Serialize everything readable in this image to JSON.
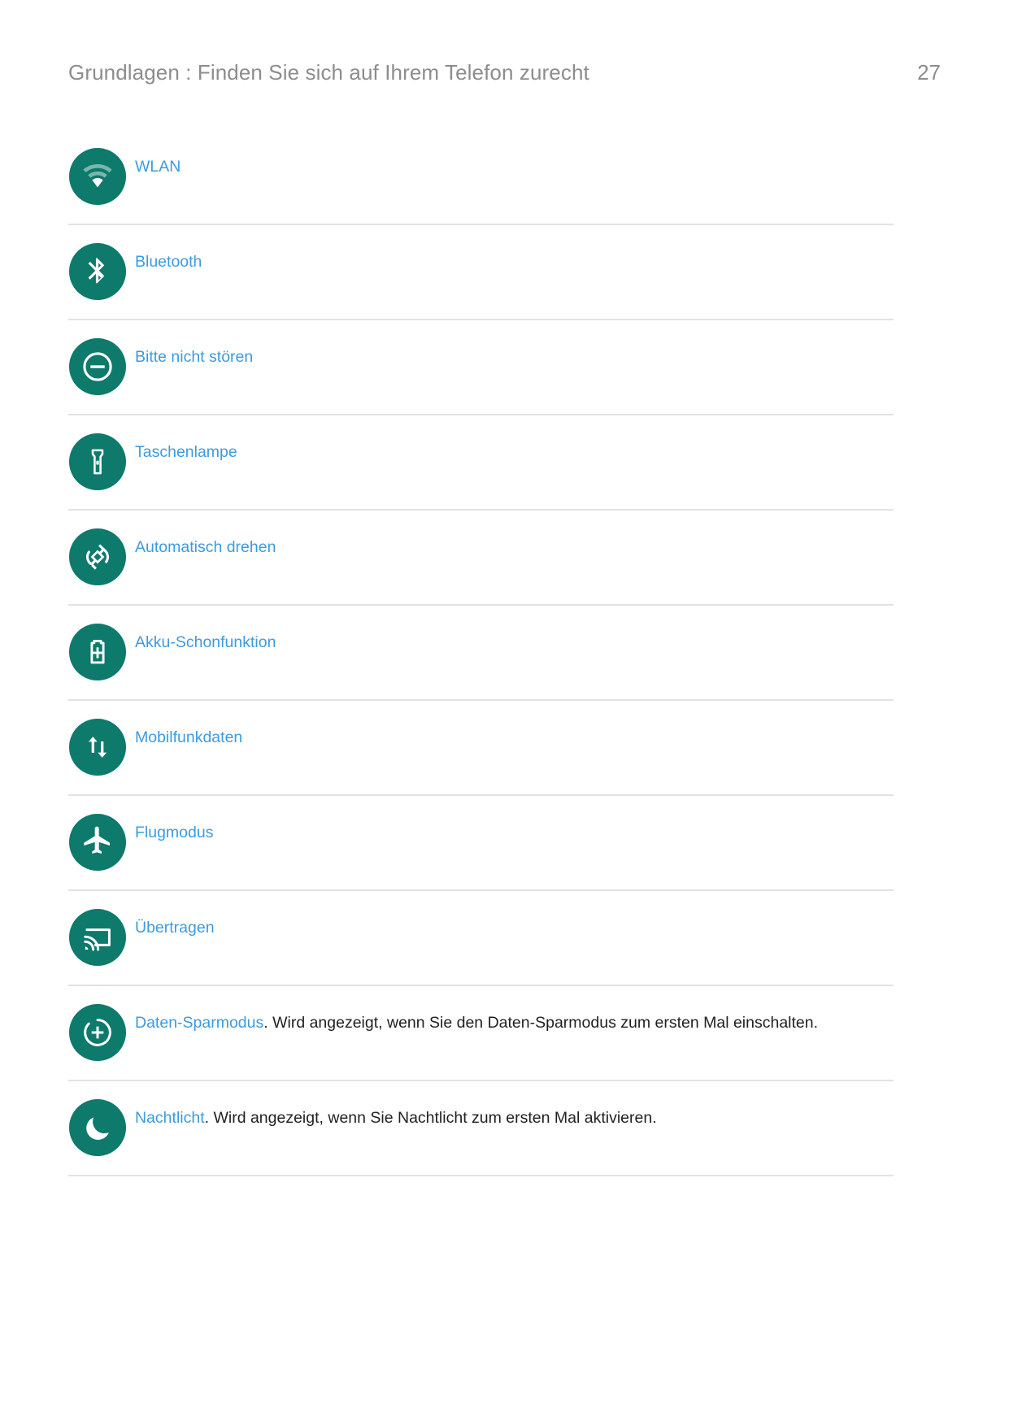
{
  "header": {
    "title": "Grundlagen : Finden Sie sich auf Ihrem Telefon zurecht",
    "page_number": "27"
  },
  "colors": {
    "icon_background": "#0d7a6b",
    "icon_glyph": "#ffffff",
    "link_text": "#3d9be0",
    "body_text": "#231f20",
    "header_text": "#8d8d8d",
    "divider": "#e2e2e2",
    "page_background": "#ffffff"
  },
  "rows": [
    {
      "icon": "wifi-icon",
      "label": "WLAN",
      "description": ""
    },
    {
      "icon": "bluetooth-icon",
      "label": "Bluetooth",
      "description": ""
    },
    {
      "icon": "do-not-disturb-icon",
      "label": "Bitte nicht stören",
      "description": ""
    },
    {
      "icon": "flashlight-icon",
      "label": "Taschenlampe",
      "description": ""
    },
    {
      "icon": "auto-rotate-icon",
      "label": "Automatisch drehen",
      "description": ""
    },
    {
      "icon": "battery-saver-icon",
      "label": "Akku-Schonfunktion",
      "description": ""
    },
    {
      "icon": "mobile-data-icon",
      "label": "Mobilfunkdaten",
      "description": ""
    },
    {
      "icon": "airplane-mode-icon",
      "label": "Flugmodus",
      "description": ""
    },
    {
      "icon": "cast-icon",
      "label": "Übertragen",
      "description": ""
    },
    {
      "icon": "data-saver-icon",
      "label": "Daten-Sparmodus",
      "description": ". Wird angezeigt, wenn Sie den Daten-Sparmodus zum ersten Mal einschalten."
    },
    {
      "icon": "night-light-icon",
      "label": "Nachtlicht",
      "description": ". Wird angezeigt, wenn Sie Nachtlicht zum ersten Mal aktivieren."
    }
  ]
}
